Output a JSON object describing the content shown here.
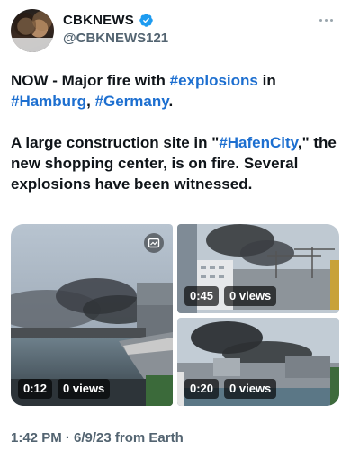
{
  "author": {
    "display_name": "CBKNEWS",
    "handle": "@CBKNEWS121",
    "verified_color": "#1d9bf0"
  },
  "tweet": {
    "line1_prefix": "NOW - Major fire with ",
    "line1_tag": "#explosions",
    "line1_suffix": " in",
    "line2_tag1": "#Hamburg",
    "line2_sep": ", ",
    "line2_tag2": "#Germany",
    "line2_end": ".",
    "para2_prefix": "A large construction site in \"",
    "para2_tag": "#HafenCity",
    "para2_suffix": ",\" the new shopping center, is on fire. Several explosions have been witnessed.",
    "hashtag_color": "#1d6fd0"
  },
  "media": {
    "videos": [
      {
        "duration": "0:12",
        "views": "0 views"
      },
      {
        "duration": "0:45",
        "views": "0 views"
      },
      {
        "duration": "0:20",
        "views": "0 views"
      }
    ]
  },
  "footer": {
    "timestamp": "1:42 PM · 6/9/23 from Earth"
  }
}
